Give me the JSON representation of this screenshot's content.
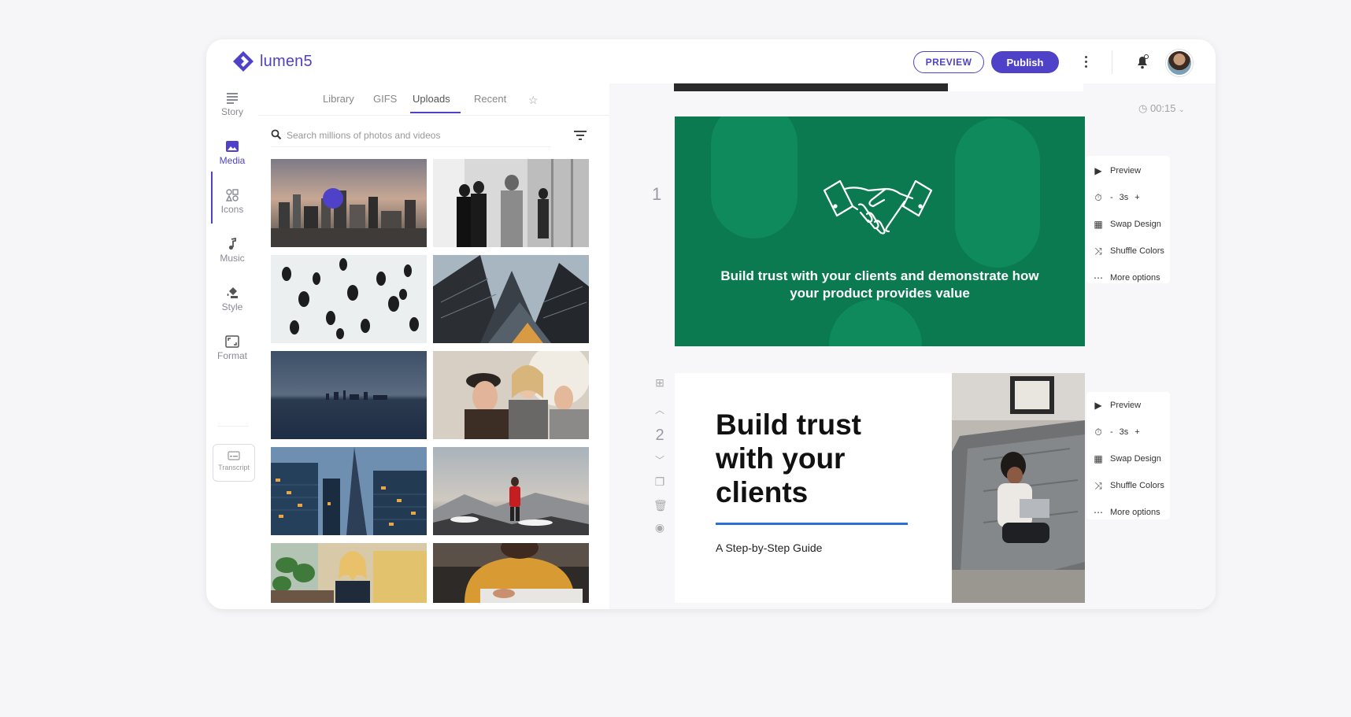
{
  "app": {
    "brand": "lumen5",
    "colors": {
      "accent": "#4f42c9",
      "slide_green": "#0b7a51",
      "rule_blue": "#2c6fd6"
    }
  },
  "header": {
    "undo_icon": "undo-icon",
    "redo_icon": "redo-icon",
    "preview_label": "PREVIEW",
    "publish_label": "Publish",
    "more_icon": "kebab-icon",
    "notifications_icon": "bell-icon"
  },
  "rail": {
    "items": [
      {
        "label": "Story",
        "icon": "story-icon"
      },
      {
        "label": "Media",
        "icon": "image-icon",
        "active": true
      },
      {
        "label": "Icons",
        "icon": "shapes-icon"
      },
      {
        "label": "Music",
        "icon": "music-note-icon"
      },
      {
        "label": "Style",
        "icon": "paint-bucket-icon"
      },
      {
        "label": "Format",
        "icon": "aspect-ratio-icon"
      }
    ],
    "transcript_label": "Transcript"
  },
  "media": {
    "tabs": [
      {
        "label": "Library"
      },
      {
        "label": "GIFS"
      },
      {
        "label": "Uploads",
        "active": true
      },
      {
        "label": "Recent"
      }
    ],
    "favorites_icon": "star-icon",
    "search": {
      "placeholder": "Search millions of photos and videos",
      "value": ""
    },
    "filter_icon": "filter-icon",
    "thumbnails": [
      "city-skyline-sunset",
      "people-walking-office",
      "crowd-aerial-snow",
      "skyscrapers-looking-up",
      "city-waterfront-dusk",
      "friends-laughing",
      "glass-towers-night",
      "hiker-mountain-snow",
      "woman-on-phone-office",
      "person-typing-laptop"
    ]
  },
  "editor": {
    "duration": "00:15",
    "slides": [
      {
        "number": "1",
        "text": "Build trust with your clients and demonstrate how your product provides value",
        "icon": "handshake-icon"
      },
      {
        "number": "2",
        "title": "Build trust with your clients",
        "subtitle": "A Step-by-Step Guide"
      }
    ],
    "slide_options": {
      "preview": "Preview",
      "duration_minus": "-",
      "duration": "3s",
      "duration_plus": "+",
      "swap_design": "Swap Design",
      "shuffle_colors": "Shuffle Colors",
      "more_options": "More options"
    }
  }
}
